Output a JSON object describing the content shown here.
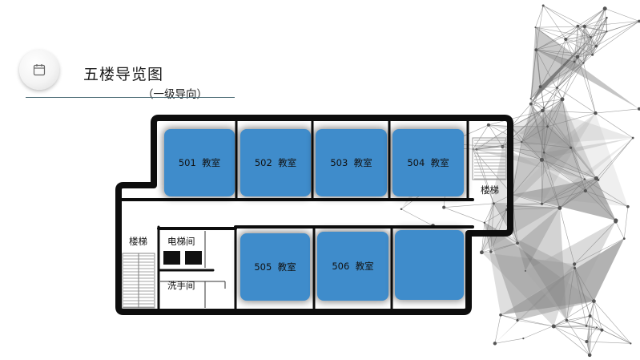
{
  "header": {
    "title": "五楼导览图",
    "subtitle": "（一级导向）",
    "icon": "calendar-icon"
  },
  "rooms": [
    {
      "id": "501",
      "label": "501  教室"
    },
    {
      "id": "502",
      "label": "502  教室"
    },
    {
      "id": "503",
      "label": "503  教室"
    },
    {
      "id": "504",
      "label": "504  教室"
    },
    {
      "id": "505",
      "label": "505  教室"
    },
    {
      "id": "506",
      "label": "506  教室"
    },
    {
      "id": "unnamed",
      "label": ""
    }
  ],
  "facilities": {
    "stairs_right": "楼梯",
    "stairs_left": "楼梯",
    "elevator": "电梯间",
    "restroom": "洗手间"
  },
  "colors": {
    "room_fill": "#3f8ccb",
    "wall": "#0d0d0d",
    "accent_line": "#4a6a75"
  }
}
